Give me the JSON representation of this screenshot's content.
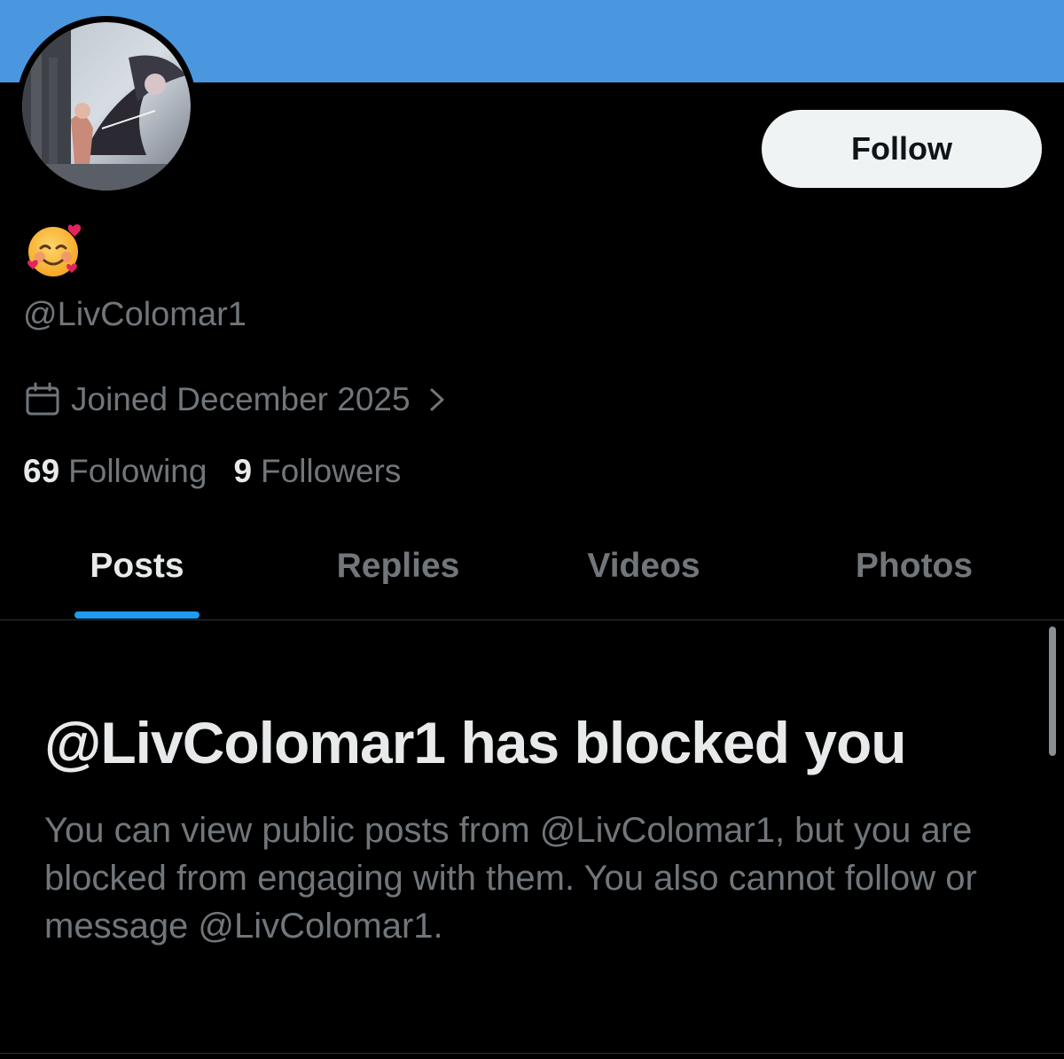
{
  "profile": {
    "display_name_emoji": "smiling-face-with-hearts",
    "handle": "@LivColomar1",
    "joined": "Joined December 2025",
    "following_count": "69",
    "following_label": "Following",
    "followers_count": "9",
    "followers_label": "Followers"
  },
  "actions": {
    "follow_label": "Follow"
  },
  "tabs": [
    {
      "label": "Posts",
      "active": true
    },
    {
      "label": "Replies",
      "active": false
    },
    {
      "label": "Videos",
      "active": false
    },
    {
      "label": "Photos",
      "active": false
    }
  ],
  "blocked": {
    "title": "@LivColomar1 has blocked you",
    "message": "You can view public posts from @LivColomar1, but you are blocked from engaging with them. You also cannot follow or message @LivColomar1."
  },
  "colors": {
    "banner": "#4a97e0",
    "accent": "#1d9bf0",
    "background": "#000000",
    "primary_text": "#e7e9ea",
    "secondary_text": "#71767b"
  },
  "icons": {
    "joined": "calendar-icon",
    "joined_chevron": "chevron-right-icon"
  }
}
